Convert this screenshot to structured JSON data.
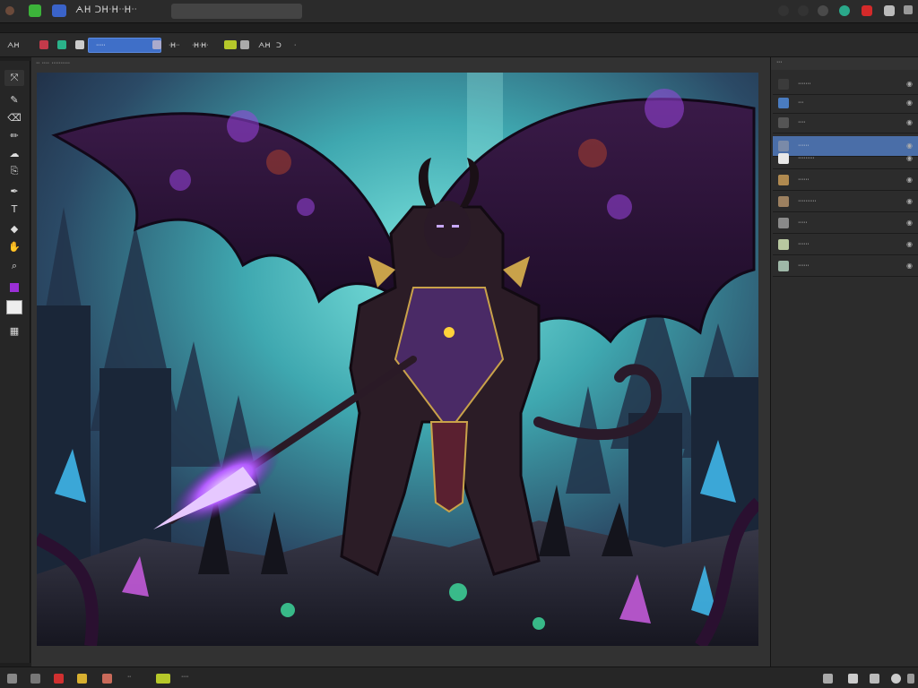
{
  "app": {
    "title": "ᗅᕼ ᑐᕼᐧᕼᐧᐧᕼᐧᐧ",
    "colors": {
      "accent": "#3f6fc8",
      "panel_bg": "#2c2c2c",
      "chrome_bg": "#2b2b2b"
    }
  },
  "titlebar": {
    "left_icons": [
      "eye-icon",
      "green-app-icon",
      "blue-app-icon"
    ],
    "right_icons": [
      "dot-icon",
      "dot-icon",
      "cloud-icon",
      "teal-icon",
      "red-icon",
      "user-icon",
      "window-icon"
    ]
  },
  "options_bar": {
    "items": [
      "ᗅᕼ",
      "ᐧ",
      "ᐧ",
      "ᐧ",
      "ᐧᕼᐧᐧ",
      "ᐧᕼᐧᕼᐧ",
      "ᗅᕼ",
      "ᑐ",
      "ᐧ"
    ],
    "field_value": "ᐧᐧᐧᐧᐧ"
  },
  "document": {
    "tab_label": "ᐧᐧ ᐧᐧᐧᐧ ᐧᐧᐧᐧᐧᐧᐧᐧᐧᐧ"
  },
  "toolbar": {
    "tools": [
      "move-icon",
      "brush-icon",
      "eraser-icon",
      "pencil-icon",
      "smudge-icon",
      "clone-icon",
      "pen-icon",
      "text-icon",
      "shape-icon",
      "hand-icon",
      "zoom-icon",
      "color-swatch-icon",
      "foreground-swatch-icon",
      "grid-icon"
    ]
  },
  "layers_panel": {
    "header": "ᐧᐧᐧ",
    "layers": [
      {
        "label": "ᐧᐧᐧᐧᐧᐧᐧ",
        "thumb": "#3b3b3b",
        "selected": false
      },
      {
        "label": "ᐧᐧᐧ",
        "thumb": "#4a7cc0",
        "selected": false
      },
      {
        "label": "ᐧᐧᐧᐧ",
        "thumb": "#555555",
        "selected": false
      },
      {
        "label": "ᐧᐧᐧᐧᐧᐧ",
        "thumb": "#7a8aa8",
        "selected": true
      },
      {
        "label": "ᐧᐧᐧᐧᐧᐧᐧᐧᐧ",
        "thumb": "#e8e8e8",
        "selected": false
      },
      {
        "label": "ᐧᐧᐧᐧᐧᐧ",
        "thumb": "#b08a50",
        "selected": false
      },
      {
        "label": "ᐧᐧᐧᐧᐧᐧᐧᐧᐧᐧ",
        "thumb": "#9c8060",
        "selected": false
      },
      {
        "label": "ᐧᐧᐧᐧᐧ",
        "thumb": "#8a8a8a",
        "selected": false
      },
      {
        "label": "ᐧᐧᐧᐧᐧᐧ",
        "thumb": "#b8c8a0",
        "selected": false
      },
      {
        "label": "ᐧᐧᐧᐧᐧᐧ",
        "thumb": "#9fb8a8",
        "selected": false
      }
    ]
  },
  "statusbar": {
    "left_icons": [
      "layers-icon",
      "red-record-icon",
      "yellow-folder-icon",
      "brush-size-icon"
    ],
    "items": [
      "ᐧᐧ",
      "ᐧᐧᐧ",
      "ᐧᐧᐧᐧ"
    ],
    "right_icons": [
      "grid-icon",
      "chat-icon",
      "mail-icon",
      "settings-icon",
      "close-icon"
    ]
  }
}
